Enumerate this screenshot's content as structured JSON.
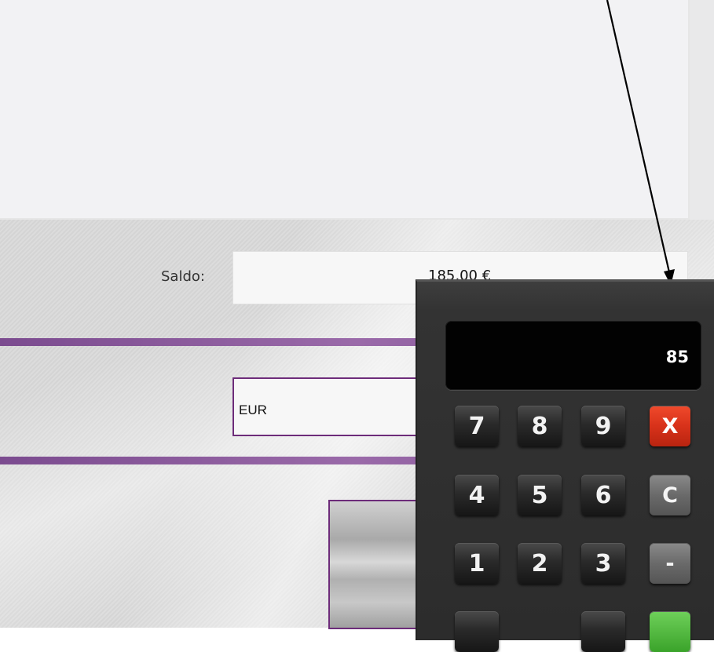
{
  "balance": {
    "label": "Saldo:",
    "value": "185,00 €"
  },
  "currency": {
    "value": "EUR"
  },
  "calculator": {
    "display": "85",
    "keys": {
      "k7": "7",
      "k8": "8",
      "k9": "9",
      "close": "X",
      "k4": "4",
      "k5": "5",
      "k6": "6",
      "clear": "C",
      "k1": "1",
      "k2": "2",
      "k3": "3",
      "minus": "-"
    }
  },
  "colors": {
    "accent_purple": "#7b4b8f",
    "close_key_red": "#e03a20",
    "ok_key_green": "#3aa32a",
    "calculator_body": "#2c2c2c"
  },
  "icons": {
    "pointer": "annotation-arrow-icon"
  }
}
